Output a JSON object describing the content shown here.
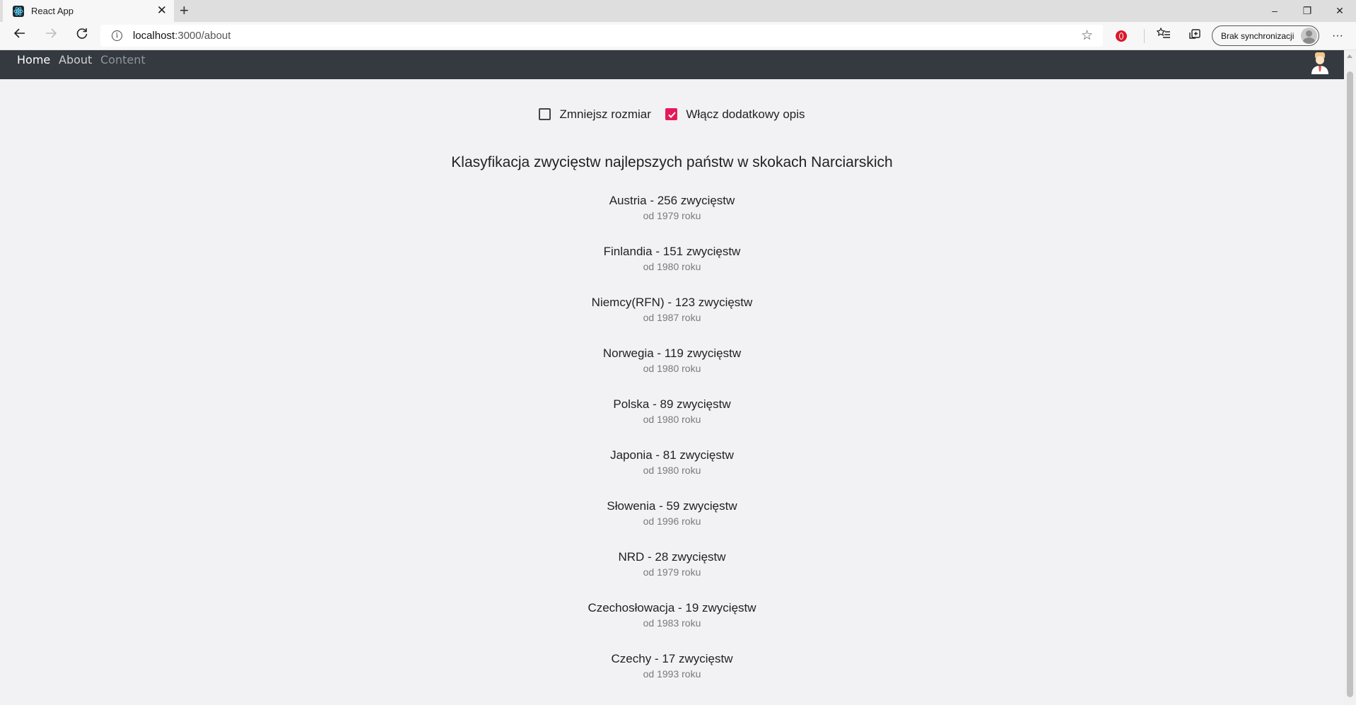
{
  "browser": {
    "tab_title": "React App",
    "tab_close": "✕",
    "new_tab": "+",
    "url_host": "localhost",
    "url_path": ":3000/about",
    "sync_label": "Brak synchronizacji",
    "window_controls": [
      "–",
      "❐",
      "✕"
    ],
    "more_glyph": "···"
  },
  "navbar": {
    "links": [
      {
        "label": "Home",
        "color": "#ffffff"
      },
      {
        "label": "About",
        "color": "#d0d0d0"
      },
      {
        "label": "Content",
        "color": "#8f959b"
      }
    ]
  },
  "options": [
    {
      "label": "Zmniejsz rozmiar",
      "checked": false
    },
    {
      "label": "Włącz dodatkowy opis",
      "checked": true
    }
  ],
  "title": "Klasyfikacja zwycięstw najlepszych państw w skokach Narciarskich",
  "countries": [
    {
      "main": "Austria - 256 zwycięstw",
      "sub": "od 1979 roku"
    },
    {
      "main": "Finlandia - 151 zwycięstw",
      "sub": "od 1980 roku"
    },
    {
      "main": "Niemcy(RFN) - 123 zwycięstw",
      "sub": "od 1987 roku"
    },
    {
      "main": "Norwegia - 119 zwycięstw",
      "sub": "od 1980 roku"
    },
    {
      "main": "Polska - 89 zwycięstw",
      "sub": "od 1980 roku"
    },
    {
      "main": "Japonia - 81 zwycięstw",
      "sub": "od 1980 roku"
    },
    {
      "main": "Słowenia - 59 zwycięstw",
      "sub": "od 1996 roku"
    },
    {
      "main": "NRD - 28 zwycięstw",
      "sub": "od 1979 roku"
    },
    {
      "main": "Czechosłowacja - 19 zwycięstw",
      "sub": "od 1983 roku"
    },
    {
      "main": "Czechy - 17 zwycięstw",
      "sub": "od 1993 roku"
    }
  ],
  "icons": {
    "back": "arrow-left-icon",
    "forward": "arrow-right-icon",
    "reload": "reload-icon",
    "favorite": "star-icon",
    "accent": "#e5195a",
    "navbar_bg": "#343a40"
  }
}
